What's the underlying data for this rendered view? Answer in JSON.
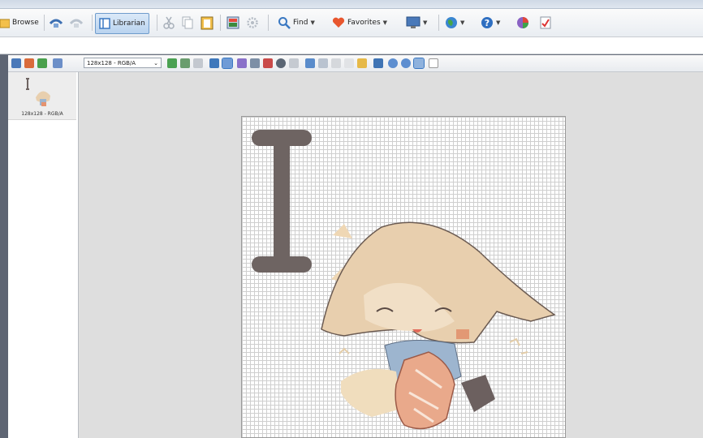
{
  "toolbar": {
    "browse_label": "Browse",
    "librarian_label": "Librarian",
    "find_label": "Find",
    "favorites_label": "Favorites"
  },
  "inner_toolbar": {
    "format_dropdown_value": "128x128 - RGB/A"
  },
  "thumbnail": {
    "label": "128x128 - RGB/A"
  },
  "colors": {
    "cursor_glyph": "#6e6462",
    "hair": "#e8cfae",
    "accent_blue": "#3a78c2"
  }
}
